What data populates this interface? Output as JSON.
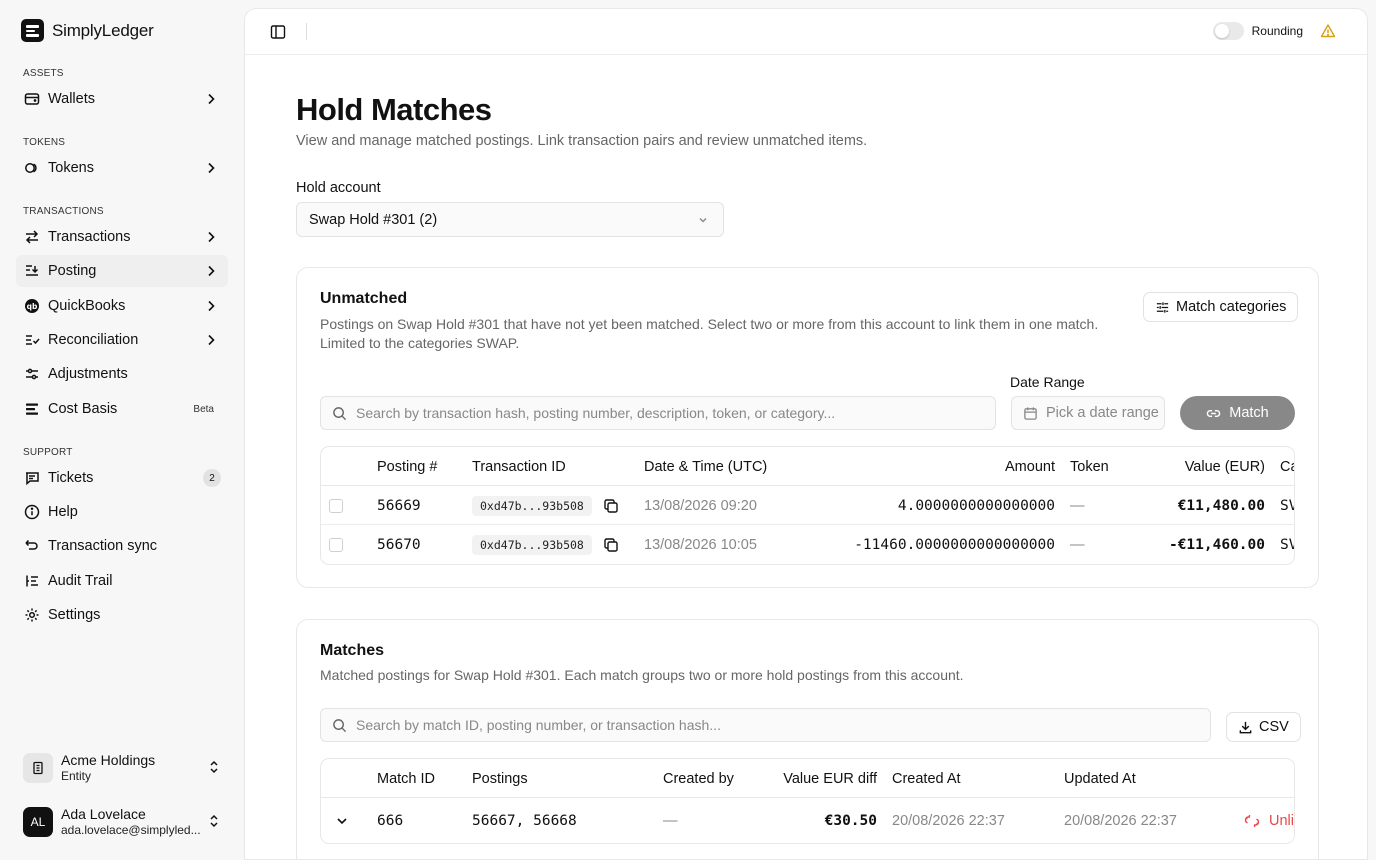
{
  "app": {
    "brand": "SimplyLedger"
  },
  "sidebar": {
    "sections": {
      "assets": "ASSETS",
      "tokens": "TOKENS",
      "transactions": "TRANSACTIONS",
      "support": "SUPPORT"
    },
    "items": {
      "wallets": "Wallets",
      "tokens": "Tokens",
      "transactions": "Transactions",
      "posting": "Posting",
      "quickbooks": "QuickBooks",
      "reconciliation": "Reconciliation",
      "adjustments": "Adjustments",
      "cost_basis": "Cost Basis",
      "cost_basis_badge": "Beta",
      "tickets": "Tickets",
      "tickets_count": "2",
      "help": "Help",
      "transaction_sync": "Transaction sync",
      "audit_trail": "Audit Trail",
      "settings": "Settings"
    },
    "entity": {
      "name": "Acme Holdings",
      "type": "Entity"
    },
    "user": {
      "initials": "AL",
      "name": "Ada Lovelace",
      "email": "ada.lovelace@simplyled..."
    }
  },
  "topbar": {
    "rounding_label": "Rounding",
    "rounding_on": false
  },
  "page": {
    "title": "Hold Matches",
    "subtitle": "View and manage matched postings. Link transaction pairs and review unmatched items.",
    "hold_account_label": "Hold account",
    "hold_account_value": "Swap Hold #301 (2)"
  },
  "unmatched": {
    "title": "Unmatched",
    "description": "Postings on Swap Hold #301 that have not yet been matched. Select two or more from this account to link them in one match. Limited to the categories SWAP.",
    "match_categories_label": "Match categories",
    "search_placeholder": "Search by transaction hash, posting number, description, token, or category...",
    "date_range_label": "Date Range",
    "date_range_placeholder": "Pick a date range",
    "match_button": "Match",
    "columns": {
      "posting": "Posting #",
      "transaction_id": "Transaction ID",
      "datetime": "Date & Time (UTC)",
      "amount": "Amount",
      "token": "Token",
      "value": "Value (EUR)",
      "category": "Ca"
    },
    "rows": [
      {
        "posting": "56669",
        "tx": "0xd47b...93b508",
        "datetime": "13/08/2026 09:20",
        "amount": "4.0000000000000000",
        "token": "—",
        "value": "€11,480.00",
        "category": "SV"
      },
      {
        "posting": "56670",
        "tx": "0xd47b...93b508",
        "datetime": "13/08/2026 10:05",
        "amount": "-11460.0000000000000000",
        "token": "—",
        "value": "-€11,460.00",
        "category": "SV"
      }
    ]
  },
  "matches": {
    "title": "Matches",
    "description": "Matched postings for Swap Hold #301. Each match groups two or more hold postings from this account.",
    "search_placeholder": "Search by match ID, posting number, or transaction hash...",
    "csv_label": "CSV",
    "columns": {
      "match_id": "Match ID",
      "postings": "Postings",
      "created_by": "Created by",
      "value_diff": "Value EUR diff",
      "created_at": "Created At",
      "updated_at": "Updated At"
    },
    "rows": [
      {
        "match_id": "666",
        "postings": "56667, 56668",
        "created_by": "—",
        "value_diff": "€30.50",
        "created_at": "20/08/2026 22:37",
        "updated_at": "20/08/2026 22:37",
        "action": "Unli"
      }
    ]
  }
}
